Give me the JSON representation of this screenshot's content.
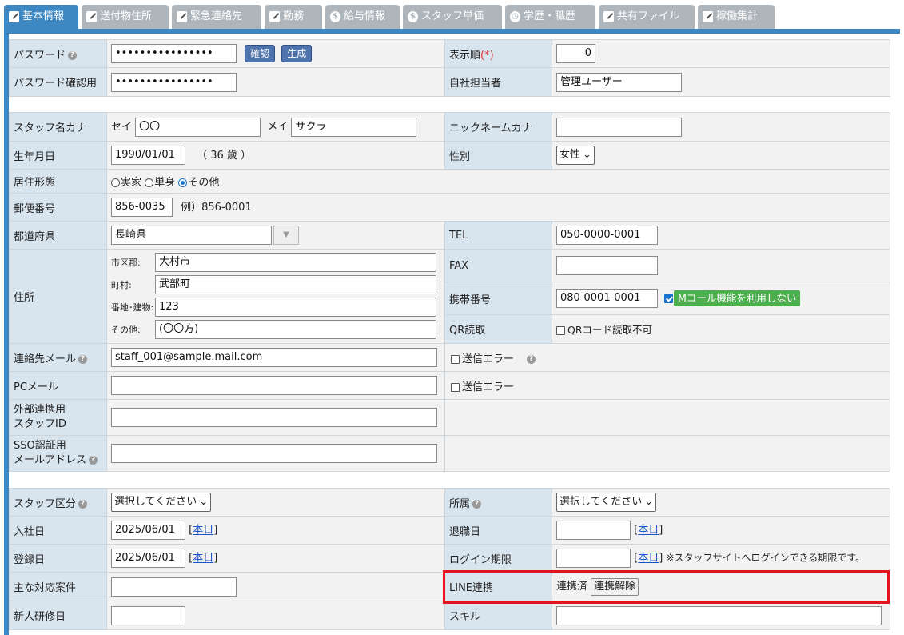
{
  "tabs": [
    {
      "label": "基本情報",
      "icon": "pen-icon"
    },
    {
      "label": "送付物住所",
      "icon": "pen-icon"
    },
    {
      "label": "緊急連絡先",
      "icon": "pen-icon"
    },
    {
      "label": "勤務",
      "icon": "pen-icon"
    },
    {
      "label": "給与情報",
      "icon": "dollar-icon"
    },
    {
      "label": "スタッフ単価",
      "icon": "dollar-icon"
    },
    {
      "label": "学歴・職歴",
      "icon": "clock-icon"
    },
    {
      "label": "共有ファイル",
      "icon": "pen-icon"
    },
    {
      "label": "稼働集計",
      "icon": "pen-icon"
    }
  ],
  "account": {
    "password_label": "パスワード",
    "password_value": "••••••••••••••••",
    "confirm_btn": "確認",
    "generate_btn": "生成",
    "order_label": "表示順",
    "required_mark": "(*)",
    "order_value": "0",
    "password_confirm_label": "パスワード確認用",
    "password_confirm_value": "••••••••••••••••",
    "manager_label": "自社担当者",
    "manager_value": "管理ユーザー"
  },
  "profile": {
    "kana_label": "スタッフ名カナ",
    "sei_label": "セイ",
    "sei_value": "〇〇",
    "mei_label": "メイ",
    "mei_value": "サクラ",
    "nickname_label": "ニックネームカナ",
    "nickname_value": "",
    "birth_label": "生年月日",
    "birth_value": "1990/01/01",
    "age_text": "（ 36 歳 ）",
    "gender_label": "性別",
    "gender_value": "女性",
    "residence_label": "居住形態",
    "residence_options": [
      "実家",
      "単身",
      "その他"
    ],
    "postal_label": "郵便番号",
    "postal_value": "856-0035",
    "postal_example": "例）856-0001",
    "pref_label": "都道府県",
    "pref_value": "長崎県",
    "tel_label": "TEL",
    "tel_value": "050-0000-0001",
    "address_label": "住所",
    "city_label": "市区郡:",
    "city_value": "大村市",
    "town_label": "町村:",
    "town_value": "武部町",
    "street_label": "番地･建物:",
    "street_value": "123",
    "other_label": "その他:",
    "other_value": "(〇〇方)",
    "fax_label": "FAX",
    "fax_value": "",
    "mobile_label": "携帯番号",
    "mobile_value": "080-0001-0001",
    "mcall_label": "Mコール機能を利用しない",
    "qr_label": "QR読取",
    "qr_check_label": "QRコード読取不可",
    "contact_mail_label": "連絡先メール",
    "contact_mail_value": "staff_001@sample.mail.com",
    "send_error_label": "送信エラー",
    "pc_mail_label": "PCメール",
    "pc_mail_value": "",
    "pc_send_error_label": "送信エラー",
    "ext_id_label_1": "外部連携用",
    "ext_id_label_2": "スタッフID",
    "ext_id_value": "",
    "sso_label_1": "SSO認証用",
    "sso_label_2": "メールアドレス",
    "sso_value": ""
  },
  "employment": {
    "category_label": "スタッフ区分",
    "category_value": "選択してください",
    "affiliation_label": "所属",
    "affiliation_value": "選択してください",
    "join_label": "入社日",
    "join_value": "2025/06/01",
    "today_link": "本日",
    "retire_label": "退職日",
    "retire_value": "",
    "register_label": "登録日",
    "register_value": "2025/06/01",
    "login_label": "ログイン期限",
    "login_value": "",
    "login_note": "※スタッフサイトへログインできる期限です。",
    "cases_label": "主な対応案件",
    "cases_value": "",
    "line_label": "LINE連携",
    "line_status": "連携済",
    "line_unlink_btn": "連携解除",
    "training_label": "新人研修日",
    "training_value": "",
    "skill_label": "スキル",
    "skill_value": ""
  }
}
